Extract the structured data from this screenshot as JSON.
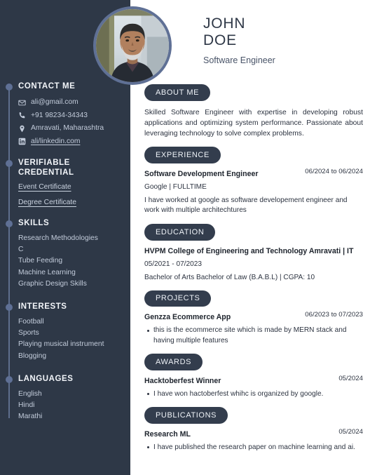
{
  "header": {
    "name_line1": "JOHN",
    "name_line2": "DOE",
    "role": "Software Engineer"
  },
  "sidebar": {
    "sections": [
      {
        "title": "CONTACT ME"
      },
      {
        "title": "VERIFIABLE CREDENTIAL"
      },
      {
        "title": "SKILLS"
      },
      {
        "title": "INTERESTS"
      },
      {
        "title": "LANGUAGES"
      }
    ],
    "contact": {
      "email": "ali@gmail.com",
      "phone": "+91 98234-34343",
      "location": "Amravati, Maharashtra",
      "linkedin": "ali/linkedin.com"
    },
    "credentials": [
      "Event Certificate",
      "Degree Certificate"
    ],
    "skills": [
      "Research Methodologies",
      "C",
      "Tube Feeding",
      "Machine Learning",
      "Graphic Design Skills"
    ],
    "interests": [
      "Football",
      "Sports",
      "Playing musical instrument",
      "Blogging"
    ],
    "languages": [
      "English",
      "Hindi",
      "Marathi"
    ]
  },
  "main": {
    "about": {
      "pill": "ABOUT ME",
      "text": "Skilled Software Engineer with expertise in developing robust applications and optimizing system performance. Passionate about leveraging technology to solve complex problems."
    },
    "experience": {
      "pill": "EXPERIENCE",
      "title": "Software Development Engineer",
      "date": "06/2024 to 06/2024",
      "company": "Google | FULLTIME",
      "description": "I have worked at google as software developement engineer and work with multiple architechtures"
    },
    "education": {
      "pill": "EDUCATION",
      "institution": "HVPM College of Engineering and Technology Amravati | IT",
      "date": "05/2021 - 07/2023",
      "degree": "Bachelor of Arts Bachelor of Law (B.A.B.L) | CGPA: 10"
    },
    "projects": {
      "pill": "PROJECTS",
      "title": "Genzza Ecommerce App",
      "date": "06/2023 to 07/2023",
      "bullet": "this is the ecommerce site which is made by MERN stack and having multiple features"
    },
    "awards": {
      "pill": "AWARDS",
      "title": "Hacktoberfest Winner",
      "date": "05/2024",
      "bullet": "I have won hactoberfest whihc is organized by google."
    },
    "publications": {
      "pill": "PUBLICATIONS",
      "title": "Research ML",
      "date": "05/2024",
      "bullet": "I have published the research paper on machine learning and ai."
    }
  },
  "colors": {
    "sidebar_bg": "#2e3847",
    "pill_bg": "#333d4d",
    "accent": "#5f7095",
    "page_bg": "#ffffff"
  }
}
